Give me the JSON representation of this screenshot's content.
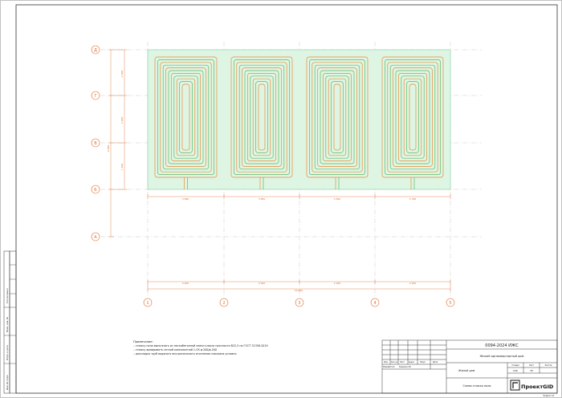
{
  "axes": {
    "columns": [
      "1",
      "2",
      "3",
      "4",
      "5"
    ],
    "rows": [
      "Д",
      "Г",
      "В",
      "Б",
      "А"
    ]
  },
  "dimensions": {
    "segments": [
      "4 900",
      "4 900",
      "4 900",
      "4 900"
    ],
    "total": "19 600",
    "top_small": [
      "3 850",
      "3 850",
      "3 850",
      "3 780"
    ],
    "left_total": "6 000",
    "left_segments": [
      "2 600",
      "2 200",
      "1 200"
    ]
  },
  "notes": {
    "heading": "Примечание:",
    "lines": [
      "– стяжку пола выполнить из пескобетонной смеси класса прочности В22,5 по ГОСТ  31358-2019",
      "– стяжку армировать сеткой композитной 1-СК ø-200/ø-200",
      "– раскладка труб водяного внутрипольного отопления показана условно"
    ]
  },
  "stamp": {
    "code": "0094-2024 ИЖС",
    "object": "Жилой одноквартирный дом",
    "part": "Жилой дом",
    "sheet_title": "Схема стяжки пола",
    "col_headers": [
      "Изм.",
      "Кол.уч",
      "Лист",
      "№док",
      "Подп.",
      "Дата"
    ],
    "developer_role": "Разработал",
    "developer_name": "Ковшов А.В.",
    "stage_label": "Стадия",
    "sheet_label": "Лист",
    "sheets_label": "Листов",
    "stage": "КЖ",
    "sheet": "35",
    "sheets": "",
    "format": "Формат А3"
  },
  "logo": {
    "text": "ПроектGID"
  },
  "left_strip": {
    "labels": [
      "Согласовано",
      "Взам. инв. №",
      "Подп. и дата",
      "Инв. № подл."
    ]
  },
  "colors": {
    "axis": "#e06a2c",
    "grid": "#c9c9c9",
    "slab": "#dff5e3",
    "pipe_orange": "#e88a3a",
    "pipe_green": "#5bb86a",
    "frame": "#333333"
  }
}
